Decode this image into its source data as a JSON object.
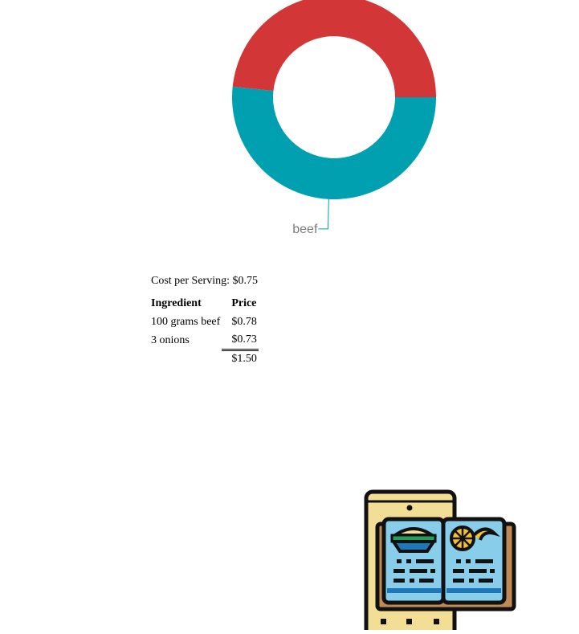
{
  "chart_data": {
    "type": "pie",
    "style": "donut",
    "categories": [
      "beef",
      "onions"
    ],
    "values": [
      0.78,
      0.73
    ],
    "colors": [
      "#00a0b0",
      "#d23636"
    ],
    "visible_labels": [
      "beef"
    ]
  },
  "summary": {
    "cost_per_serving_label": "Cost per Serving:",
    "cost_per_serving_value": "$0.75"
  },
  "table": {
    "headers": [
      "Ingredient",
      "Price"
    ],
    "rows": [
      {
        "ingredient": "100 grams beef",
        "price": "$0.78"
      },
      {
        "ingredient": "3 onions",
        "price": "$0.73"
      }
    ],
    "total": "$1.50"
  },
  "icons": {
    "recipe_app": "recipe-book-phone-icon"
  },
  "colors": {
    "beef": "#00a0b0",
    "onions": "#d23636",
    "label_text": "#7a7a7a"
  }
}
